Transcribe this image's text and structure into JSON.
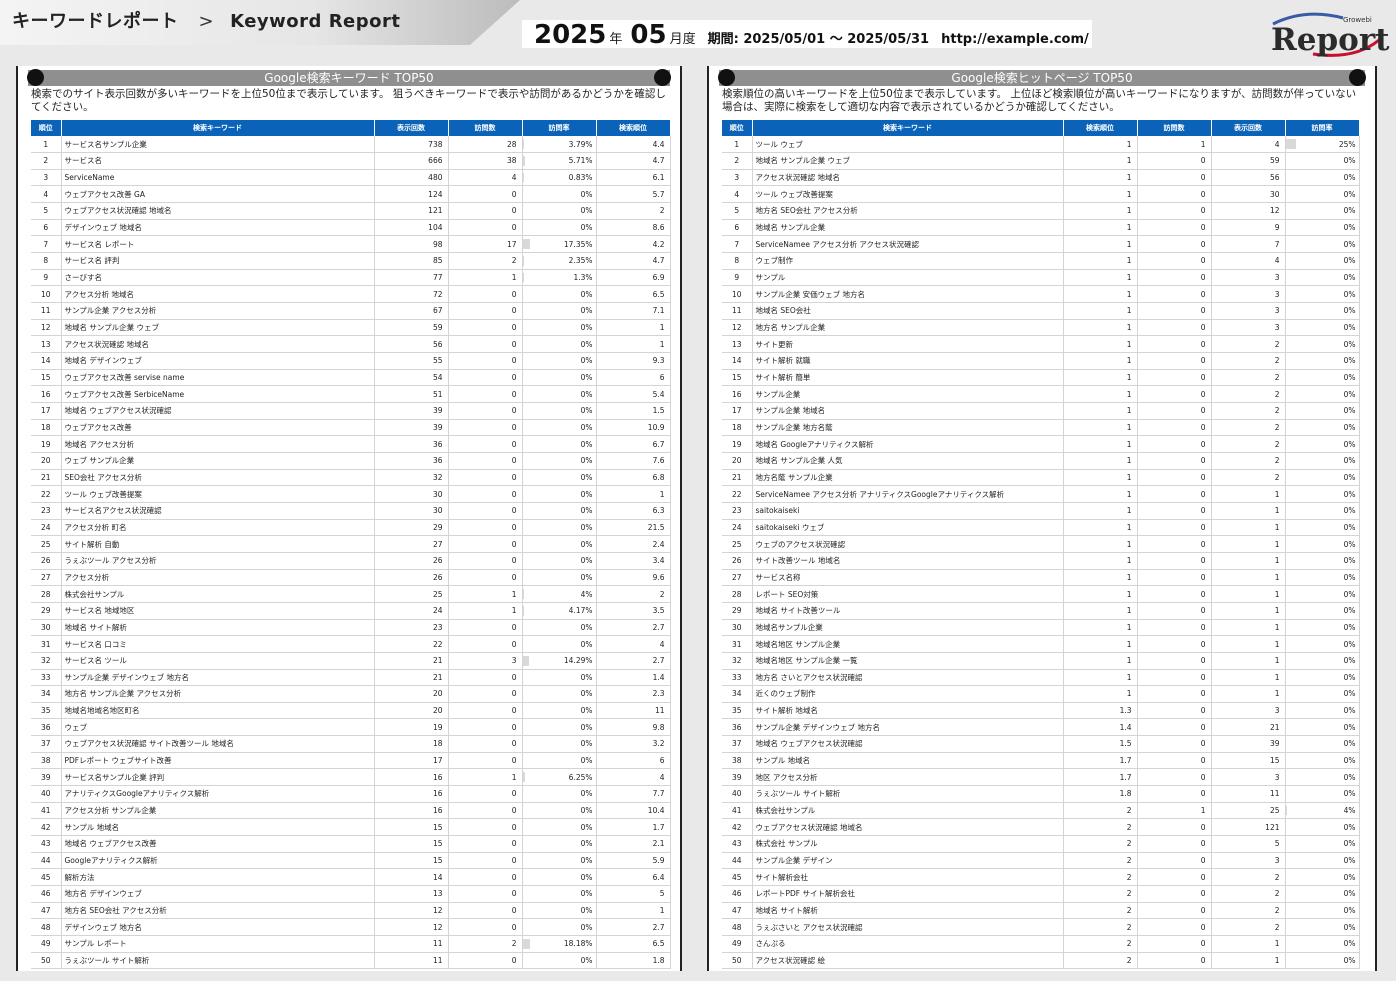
{
  "header": {
    "title_jp": "キーワードレポート",
    "separator": ">",
    "title_en": "Keyword Report",
    "year": "2025",
    "year_unit": "年",
    "month": "05",
    "month_unit": "月度",
    "period": "期間: 2025/05/01 〜 2025/05/31",
    "url": "http://example.com/",
    "logo_text": "Report",
    "logo_sub": "Growebi"
  },
  "left": {
    "title": "Google検索キーワード TOP50",
    "desc": "検索でのサイト表示回数が多いキーワードを上位50位まで表示しています。 狙うべきキーワードで表示や訪問があるかどうかを確認してください。",
    "columns": [
      "順位",
      "検索キーワード",
      "表示回数",
      "訪問数",
      "訪問率",
      "検索順位"
    ],
    "rows": [
      [
        "1",
        "サービス名サンプル企業",
        "738",
        "28",
        "3.79%",
        "4.4"
      ],
      [
        "2",
        "サービス名",
        "666",
        "38",
        "5.71%",
        "4.7"
      ],
      [
        "3",
        "ServiceName",
        "480",
        "4",
        "0.83%",
        "6.1"
      ],
      [
        "4",
        "ウェブアクセス改善 GA",
        "124",
        "0",
        "0%",
        "5.7"
      ],
      [
        "5",
        "ウェブアクセス状況確認 地域名",
        "121",
        "0",
        "0%",
        "2"
      ],
      [
        "6",
        "デザインウェブ 地域名",
        "104",
        "0",
        "0%",
        "8.6"
      ],
      [
        "7",
        "サービス名 レポート",
        "98",
        "17",
        "17.35%",
        "4.2"
      ],
      [
        "8",
        "サービス名 評判",
        "85",
        "2",
        "2.35%",
        "4.7"
      ],
      [
        "9",
        "さーびす名",
        "77",
        "1",
        "1.3%",
        "6.9"
      ],
      [
        "10",
        "アクセス分析 地域名",
        "72",
        "0",
        "0%",
        "6.5"
      ],
      [
        "11",
        "サンプル企業 アクセス分析",
        "67",
        "0",
        "0%",
        "7.1"
      ],
      [
        "12",
        "地域名 サンプル企業 ウェブ",
        "59",
        "0",
        "0%",
        "1"
      ],
      [
        "13",
        "アクセス状況確認 地域名",
        "56",
        "0",
        "0%",
        "1"
      ],
      [
        "14",
        "地域名 デザインウェブ",
        "55",
        "0",
        "0%",
        "9.3"
      ],
      [
        "15",
        "ウェブアクセス改善 servise name",
        "54",
        "0",
        "0%",
        "6"
      ],
      [
        "16",
        "ウェブアクセス改善 SerbiceName",
        "51",
        "0",
        "0%",
        "5.4"
      ],
      [
        "17",
        "地域名 ウェブアクセス状況確認",
        "39",
        "0",
        "0%",
        "1.5"
      ],
      [
        "18",
        "ウェブアクセス改善",
        "39",
        "0",
        "0%",
        "10.9"
      ],
      [
        "19",
        "地域名 アクセス分析",
        "36",
        "0",
        "0%",
        "6.7"
      ],
      [
        "20",
        "ウェブ サンプル企業",
        "36",
        "0",
        "0%",
        "7.6"
      ],
      [
        "21",
        "SEO会社 アクセス分析",
        "32",
        "0",
        "0%",
        "6.8"
      ],
      [
        "22",
        "ツール ウェブ改善提案",
        "30",
        "0",
        "0%",
        "1"
      ],
      [
        "23",
        "サービス名アクセス状況確認",
        "30",
        "0",
        "0%",
        "6.3"
      ],
      [
        "24",
        "アクセス分析 町名",
        "29",
        "0",
        "0%",
        "21.5"
      ],
      [
        "25",
        "サイト解析 自動",
        "27",
        "0",
        "0%",
        "2.4"
      ],
      [
        "26",
        "うぇぶツール アクセス分析",
        "26",
        "0",
        "0%",
        "3.4"
      ],
      [
        "27",
        "アクセス分析",
        "26",
        "0",
        "0%",
        "9.6"
      ],
      [
        "28",
        "株式会社サンプル",
        "25",
        "1",
        "4%",
        "2"
      ],
      [
        "29",
        "サービス名 地域地区",
        "24",
        "1",
        "4.17%",
        "3.5"
      ],
      [
        "30",
        "地域名 サイト解析",
        "23",
        "0",
        "0%",
        "2.7"
      ],
      [
        "31",
        "サービス名 口コミ",
        "22",
        "0",
        "0%",
        "4"
      ],
      [
        "32",
        "サービス名 ツール",
        "21",
        "3",
        "14.29%",
        "2.7"
      ],
      [
        "33",
        "サンプル企業 デザインウェブ 地方名",
        "21",
        "0",
        "0%",
        "1.4"
      ],
      [
        "34",
        "地方名 サンプル企業 アクセス分析",
        "20",
        "0",
        "0%",
        "2.3"
      ],
      [
        "35",
        "地域名地域名地区町名",
        "20",
        "0",
        "0%",
        "11"
      ],
      [
        "36",
        "ウェブ",
        "19",
        "0",
        "0%",
        "9.8"
      ],
      [
        "37",
        "ウェブアクセス状況確認 サイト改善ツール 地域名",
        "18",
        "0",
        "0%",
        "3.2"
      ],
      [
        "38",
        "PDFレポート ウェブサイト改善",
        "17",
        "0",
        "0%",
        "6"
      ],
      [
        "39",
        "サービス名サンプル企業 評判",
        "16",
        "1",
        "6.25%",
        "4"
      ],
      [
        "40",
        "アナリティクスGoogleアナリティクス解析",
        "16",
        "0",
        "0%",
        "7.7"
      ],
      [
        "41",
        "アクセス分析 サンプル企業",
        "16",
        "0",
        "0%",
        "10.4"
      ],
      [
        "42",
        "サンプル 地域名",
        "15",
        "0",
        "0%",
        "1.7"
      ],
      [
        "43",
        "地域名 ウェブアクセス改善",
        "15",
        "0",
        "0%",
        "2.1"
      ],
      [
        "44",
        "Googleアナリティクス解析",
        "15",
        "0",
        "0%",
        "5.9"
      ],
      [
        "45",
        "解析方法",
        "14",
        "0",
        "0%",
        "6.4"
      ],
      [
        "46",
        "地方名 デザインウェブ",
        "13",
        "0",
        "0%",
        "5"
      ],
      [
        "47",
        "地方名 SEO会社 アクセス分析",
        "12",
        "0",
        "0%",
        "1"
      ],
      [
        "48",
        "デザインウェブ 地方名",
        "12",
        "0",
        "0%",
        "2.7"
      ],
      [
        "49",
        "サンプル レポート",
        "11",
        "2",
        "18.18%",
        "6.5"
      ],
      [
        "50",
        "うぇぶツール サイト解析",
        "11",
        "0",
        "0%",
        "1.8"
      ]
    ]
  },
  "right": {
    "title": "Google検索ヒットページ TOP50",
    "desc": "検索順位の高いキーワードを上位50位まで表示しています。 上位ほど検索順位が高いキーワードになりますが、訪問数が伴っていない場合は、実際に検索をして適切な内容で表示されているかどうか確認してください。",
    "columns": [
      "順位",
      "検索キーワード",
      "検索順位",
      "訪問数",
      "表示回数",
      "訪問率"
    ],
    "rows": [
      [
        "1",
        "ツール ウェブ",
        "1",
        "1",
        "4",
        "25%"
      ],
      [
        "2",
        "地域名 サンプル企業 ウェブ",
        "1",
        "0",
        "59",
        "0%"
      ],
      [
        "3",
        "アクセス状況確認 地域名",
        "1",
        "0",
        "56",
        "0%"
      ],
      [
        "4",
        "ツール ウェブ改善提案",
        "1",
        "0",
        "30",
        "0%"
      ],
      [
        "5",
        "地方名 SEO会社 アクセス分析",
        "1",
        "0",
        "12",
        "0%"
      ],
      [
        "6",
        "地域名 サンプル企業",
        "1",
        "0",
        "9",
        "0%"
      ],
      [
        "7",
        "ServiceNamee アクセス分析 アクセス状況確認",
        "1",
        "0",
        "7",
        "0%"
      ],
      [
        "8",
        "ウェブ制作",
        "1",
        "0",
        "4",
        "0%"
      ],
      [
        "9",
        "サンプル",
        "1",
        "0",
        "3",
        "0%"
      ],
      [
        "10",
        "サンプル企業 安価ウェブ 地方名",
        "1",
        "0",
        "3",
        "0%"
      ],
      [
        "11",
        "地域名 SEO会社",
        "1",
        "0",
        "3",
        "0%"
      ],
      [
        "12",
        "地方名 サンプル企業",
        "1",
        "0",
        "3",
        "0%"
      ],
      [
        "13",
        "サイト更新",
        "1",
        "0",
        "2",
        "0%"
      ],
      [
        "14",
        "サイト解析 就職",
        "1",
        "0",
        "2",
        "0%"
      ],
      [
        "15",
        "サイト解析 簡単",
        "1",
        "0",
        "2",
        "0%"
      ],
      [
        "16",
        "サンプル企業",
        "1",
        "0",
        "2",
        "0%"
      ],
      [
        "17",
        "サンプル企業 地域名",
        "1",
        "0",
        "2",
        "0%"
      ],
      [
        "18",
        "サンプル企業 地方名䕃",
        "1",
        "0",
        "2",
        "0%"
      ],
      [
        "19",
        "地域名 Googleアナリティクス解析",
        "1",
        "0",
        "2",
        "0%"
      ],
      [
        "20",
        "地域名 サンプル企業 人気",
        "1",
        "0",
        "2",
        "0%"
      ],
      [
        "21",
        "地方名䕃 サンプル企業",
        "1",
        "0",
        "2",
        "0%"
      ],
      [
        "22",
        "ServiceNamee アクセス分析 アナリティクスGoogleアナリティクス解析",
        "1",
        "0",
        "1",
        "0%"
      ],
      [
        "23",
        "saitokaiseki",
        "1",
        "0",
        "1",
        "0%"
      ],
      [
        "24",
        "saitokaiseki ウェブ",
        "1",
        "0",
        "1",
        "0%"
      ],
      [
        "25",
        "ウェブのアクセス状況確認",
        "1",
        "0",
        "1",
        "0%"
      ],
      [
        "26",
        "サイト改善ツール 地域名",
        "1",
        "0",
        "1",
        "0%"
      ],
      [
        "27",
        "サービス名称",
        "1",
        "0",
        "1",
        "0%"
      ],
      [
        "28",
        "レポート SEO対策",
        "1",
        "0",
        "1",
        "0%"
      ],
      [
        "29",
        "地域名 サイト改善ツール",
        "1",
        "0",
        "1",
        "0%"
      ],
      [
        "30",
        "地域名サンプル企業",
        "1",
        "0",
        "1",
        "0%"
      ],
      [
        "31",
        "地域名地区 サンプル企業",
        "1",
        "0",
        "1",
        "0%"
      ],
      [
        "32",
        "地域名地区 サンプル企業 一覧",
        "1",
        "0",
        "1",
        "0%"
      ],
      [
        "33",
        "地方名 さいとアクセス状況確認",
        "1",
        "0",
        "1",
        "0%"
      ],
      [
        "34",
        "近くのウェブ制作",
        "1",
        "0",
        "1",
        "0%"
      ],
      [
        "35",
        "サイト解析 地域名",
        "1.3",
        "0",
        "3",
        "0%"
      ],
      [
        "36",
        "サンプル企業 デザインウェブ 地方名",
        "1.4",
        "0",
        "21",
        "0%"
      ],
      [
        "37",
        "地域名 ウェブアクセス状況確認",
        "1.5",
        "0",
        "39",
        "0%"
      ],
      [
        "38",
        "サンプル 地域名",
        "1.7",
        "0",
        "15",
        "0%"
      ],
      [
        "39",
        "地区 アクセス分析",
        "1.7",
        "0",
        "3",
        "0%"
      ],
      [
        "40",
        "うぇぶツール サイト解析",
        "1.8",
        "0",
        "11",
        "0%"
      ],
      [
        "41",
        "株式会社サンプル",
        "2",
        "1",
        "25",
        "4%"
      ],
      [
        "42",
        "ウェブアクセス状況確認 地域名",
        "2",
        "0",
        "121",
        "0%"
      ],
      [
        "43",
        "株式会社 サンプル",
        "2",
        "0",
        "5",
        "0%"
      ],
      [
        "44",
        "サンプル企業 デザイン",
        "2",
        "0",
        "3",
        "0%"
      ],
      [
        "45",
        "サイト解析会社",
        "2",
        "0",
        "2",
        "0%"
      ],
      [
        "46",
        "レポートPDF サイト解析会社",
        "2",
        "0",
        "2",
        "0%"
      ],
      [
        "47",
        "地域名 サイト解析",
        "2",
        "0",
        "2",
        "0%"
      ],
      [
        "48",
        "うぇぶさいと アクセス状況確認",
        "2",
        "0",
        "2",
        "0%"
      ],
      [
        "49",
        "さんぷる",
        "2",
        "0",
        "1",
        "0%"
      ],
      [
        "50",
        "アクセス状況確認 絵",
        "2",
        "0",
        "1",
        "0%"
      ]
    ]
  }
}
